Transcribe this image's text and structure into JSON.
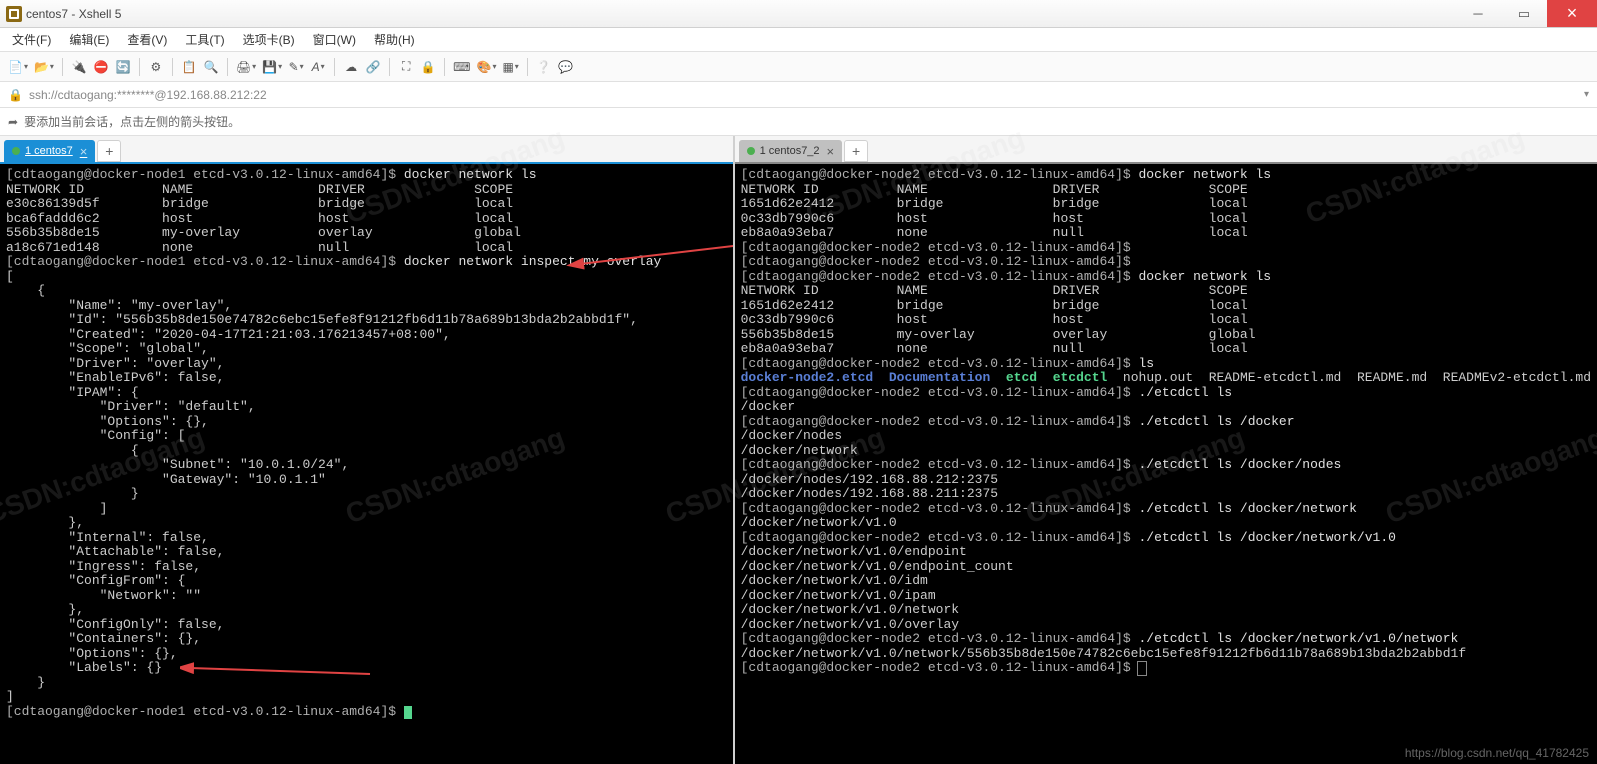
{
  "title": "centos7 - Xshell 5",
  "menu": [
    "文件(F)",
    "编辑(E)",
    "查看(V)",
    "工具(T)",
    "选项卡(B)",
    "窗口(W)",
    "帮助(H)"
  ],
  "address": "ssh://cdtaogang:********@192.168.88.212:22",
  "hint": "要添加当前会话，点击左侧的箭头按钮。",
  "tabs": {
    "left": "1 centos7",
    "right": "1 centos7_2",
    "add": "+"
  },
  "left": {
    "p1": "[cdtaogang@docker-node1 etcd-v3.0.12-linux-amd64]$ ",
    "c1": "docker network ls",
    "hdr": "NETWORK ID          NAME                DRIVER              SCOPE",
    "r1": "e30c86139d5f        bridge              bridge              local",
    "r2": "bca6faddd6c2        host                host                local",
    "r3": "556b35b8de15        my-overlay          overlay             global",
    "r4": "a18c671ed148        none                null                local",
    "c2": "docker network inspect my-overlay",
    "json": "[\n    {\n        \"Name\": \"my-overlay\",\n        \"Id\": \"556b35b8de150e74782c6ebc15efe8f91212fb6d11b78a689b13bda2b2abbd1f\",\n        \"Created\": \"2020-04-17T21:21:03.176213457+08:00\",\n        \"Scope\": \"global\",\n        \"Driver\": \"overlay\",\n        \"EnableIPv6\": false,\n        \"IPAM\": {\n            \"Driver\": \"default\",\n            \"Options\": {},\n            \"Config\": [\n                {\n                    \"Subnet\": \"10.0.1.0/24\",\n                    \"Gateway\": \"10.0.1.1\"\n                }\n            ]\n        },\n        \"Internal\": false,\n        \"Attachable\": false,\n        \"Ingress\": false,\n        \"ConfigFrom\": {\n            \"Network\": \"\"\n        },\n        \"ConfigOnly\": false,\n        \"Containers\": {},\n        \"Options\": {},\n        \"Labels\": {}\n    }\n]"
  },
  "right": {
    "p": "[cdtaogang@docker-node2 etcd-v3.0.12-linux-amd64]$ ",
    "c1": "docker network ls",
    "hdr": "NETWORK ID          NAME                DRIVER              SCOPE",
    "a1": "1651d62e2412        bridge              bridge              local",
    "a2": "0c33db7990c6        host                host                local",
    "a3": "eb8a0a93eba7        none                null                local",
    "c2": "docker network ls",
    "b1": "1651d62e2412        bridge              bridge              local",
    "b2": "0c33db7990c6        host                host                local",
    "b3": "556b35b8de15        my-overlay          overlay             global",
    "b4": "eb8a0a93eba7        none                null                local",
    "c3": "ls",
    "ls_svc": "docker-node2.etcd",
    "ls_doc": "Documentation",
    "ls_etcd": "etcd",
    "ls_ctl": "etcdctl",
    "ls_files": "nohup.out  README-etcdctl.md  README.md  READMEv2-etcdctl.md",
    "c4": "./etcdctl ls",
    "o4": "/docker",
    "c5": "./etcdctl ls /docker",
    "o5a": "/docker/nodes",
    "o5b": "/docker/network",
    "c6": "./etcdctl ls /docker/nodes",
    "o6a": "/docker/nodes/192.168.88.212:2375",
    "o6b": "/docker/nodes/192.168.88.211:2375",
    "c7": "./etcdctl ls /docker/network",
    "o7": "/docker/network/v1.0",
    "c8": "./etcdctl ls /docker/network/v1.0",
    "o8a": "/docker/network/v1.0/endpoint",
    "o8b": "/docker/network/v1.0/endpoint_count",
    "o8c": "/docker/network/v1.0/idm",
    "o8d": "/docker/network/v1.0/ipam",
    "o8e": "/docker/network/v1.0/network",
    "o8f": "/docker/network/v1.0/overlay",
    "c9": "./etcdctl ls /docker/network/v1.0/network",
    "o9": "/docker/network/v1.0/network/556b35b8de150e74782c6ebc15efe8f91212fb6d11b78a689b13bda2b2abbd1f"
  },
  "watermark": "CSDN:cdtaogang",
  "footer": "https://blog.csdn.net/qq_41782425"
}
